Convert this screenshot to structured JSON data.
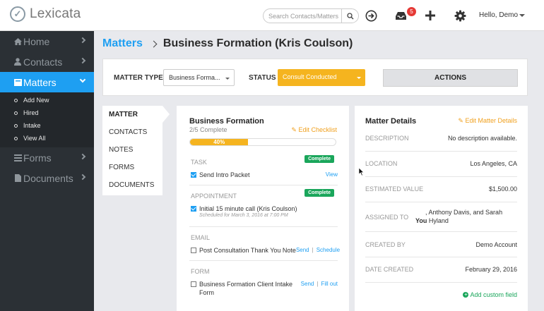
{
  "app": {
    "name": "Lexicata"
  },
  "topbar": {
    "search_placeholder": "Search Contacts/Matters",
    "notifications_count": "5",
    "user_greeting": "Hello, Demo"
  },
  "sidebar": {
    "items": [
      {
        "label": "Home"
      },
      {
        "label": "Contacts"
      },
      {
        "label": "Matters"
      },
      {
        "label": "Forms"
      },
      {
        "label": "Documents"
      }
    ],
    "sub_items": [
      {
        "label": "Add New"
      },
      {
        "label": "Hired"
      },
      {
        "label": "Intake"
      },
      {
        "label": "View All"
      }
    ]
  },
  "breadcrumb": {
    "section": "Matters",
    "title": "Business Formation (Kris Coulson)"
  },
  "filter": {
    "type_label": "MATTER TYPE",
    "type_value": "Business Forma...",
    "status_label": "STATUS",
    "status_value": "Consult Conducted",
    "actions_label": "ACTIONS",
    "status_color": "#f5b41f"
  },
  "tabs": [
    {
      "label": "MATTER"
    },
    {
      "label": "CONTACTS"
    },
    {
      "label": "NOTES"
    },
    {
      "label": "FORMS"
    },
    {
      "label": "DOCUMENTS"
    }
  ],
  "checklist": {
    "title": "Business Formation",
    "count": "2/5 Complete",
    "edit_label": "Edit Checklist",
    "progress_label": "40%",
    "progress": 0.4,
    "sections": [
      {
        "label": "TASK",
        "badge": "Complete",
        "item": "Send Intro Packet",
        "link1": "View"
      },
      {
        "label": "APPOINTMENT",
        "badge": "Complete",
        "item": "Initial 15 minute call (Kris Coulson)",
        "note": "Scheduled for March 3, 2016 at 7:00 PM"
      },
      {
        "label": "EMAIL",
        "item": "Post Consultation Thank You Note",
        "link1": "Send",
        "link2": "Schedule"
      },
      {
        "label": "FORM",
        "item": "Business Formation Client Intake Form",
        "link1": "Send",
        "link2": "Fill out"
      }
    ]
  },
  "details": {
    "title": "Matter Details",
    "edit_label": "Edit Matter Details",
    "rows": [
      {
        "label": "DESCRIPTION",
        "value": "No description available."
      },
      {
        "label": "LOCATION",
        "value": "Los Angeles, CA"
      },
      {
        "label": "ESTIMATED VALUE",
        "value": "$1,500.00"
      },
      {
        "label": "ASSIGNED TO",
        "value_line1": ", Anthony Davis, and Sarah",
        "value_bold": "You",
        "value_line2": "Hyland"
      },
      {
        "label": "CREATED BY",
        "value": "Demo Account"
      },
      {
        "label": "DATE CREATED",
        "value": "February 29, 2016"
      }
    ],
    "add_field_label": "Add custom field"
  }
}
